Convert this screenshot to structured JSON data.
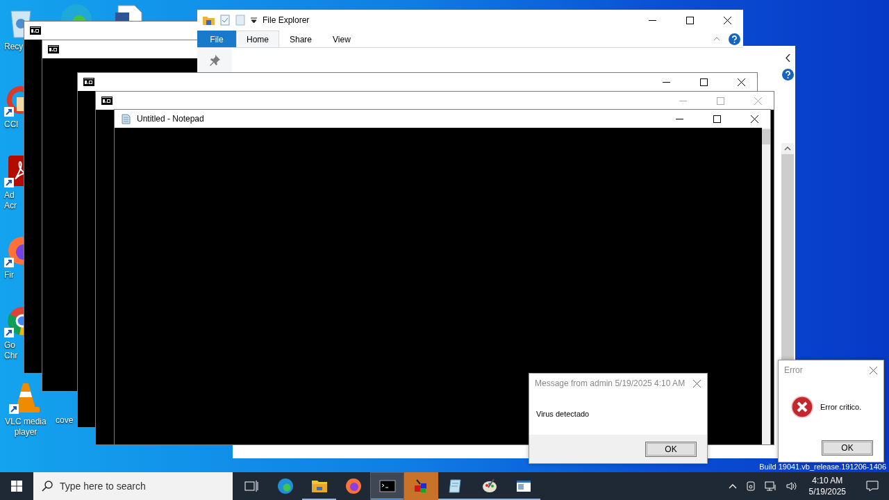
{
  "desktop_icons": [
    {
      "kind": "bin",
      "lines": [
        "Recy"
      ]
    },
    {
      "kind": "edge"
    },
    {
      "kind": "doc"
    },
    {
      "kind": "cleaner",
      "lines": [
        "CCl"
      ]
    },
    {
      "kind": "pdf",
      "lines": [
        "Ad",
        "Acr"
      ]
    },
    {
      "kind": "fox",
      "lines": [
        "Fir"
      ]
    },
    {
      "kind": "chrome",
      "lines": [
        "Go",
        "Chr"
      ]
    },
    {
      "kind": "cone",
      "lines": [
        "VLC media",
        "player"
      ]
    },
    {
      "kind": "label",
      "lines": [
        "cove"
      ]
    }
  ],
  "windows": [
    {
      "kind": "console"
    },
    {
      "kind": "console"
    },
    {
      "kind": "explorer-back"
    },
    {
      "kind": "explorer",
      "title": "File Explorer",
      "ribbon_tabs": [
        {
          "kind": "file",
          "label": "File",
          "selected": false
        },
        {
          "kind": "tab",
          "label": "Home",
          "selected": true
        },
        {
          "kind": "tab",
          "label": "Share",
          "selected": false
        },
        {
          "kind": "tab",
          "label": "View",
          "selected": false
        }
      ]
    },
    {
      "kind": "console",
      "active": true
    },
    {
      "kind": "console",
      "active": false
    },
    {
      "kind": "notepad",
      "title": "Untitled - Notepad",
      "active": true
    }
  ],
  "dialogs": [
    {
      "kind": "message",
      "title": "Message from admin 5/19/2025 4:10 AM",
      "text": "Virus detectado",
      "button": "OK"
    },
    {
      "kind": "error",
      "title": "Error",
      "text": "Error critico.",
      "button": "OK"
    }
  ],
  "build_text": "Build 19041.vb_release.191206-1406",
  "taskbar": {
    "search_placeholder": "Type here to search",
    "apps": [
      {
        "kind": "task-view",
        "running": false,
        "selected": false,
        "attention": false
      },
      {
        "kind": "edge",
        "running": false,
        "selected": false,
        "attention": false
      },
      {
        "kind": "folder",
        "running": true,
        "selected": false,
        "attention": false
      },
      {
        "kind": "fox",
        "running": false,
        "selected": false,
        "attention": false
      },
      {
        "kind": "console",
        "running": true,
        "selected": true,
        "attention": false
      },
      {
        "kind": "cubes",
        "running": false,
        "selected": false,
        "attention": true
      },
      {
        "kind": "notebook",
        "running": true,
        "selected": false,
        "attention": false
      },
      {
        "kind": "palette",
        "running": true,
        "selected": false,
        "attention": false
      },
      {
        "kind": "window",
        "running": true,
        "selected": false,
        "attention": false
      }
    ],
    "time": "4:10 AM",
    "date": "5/19/2025"
  }
}
